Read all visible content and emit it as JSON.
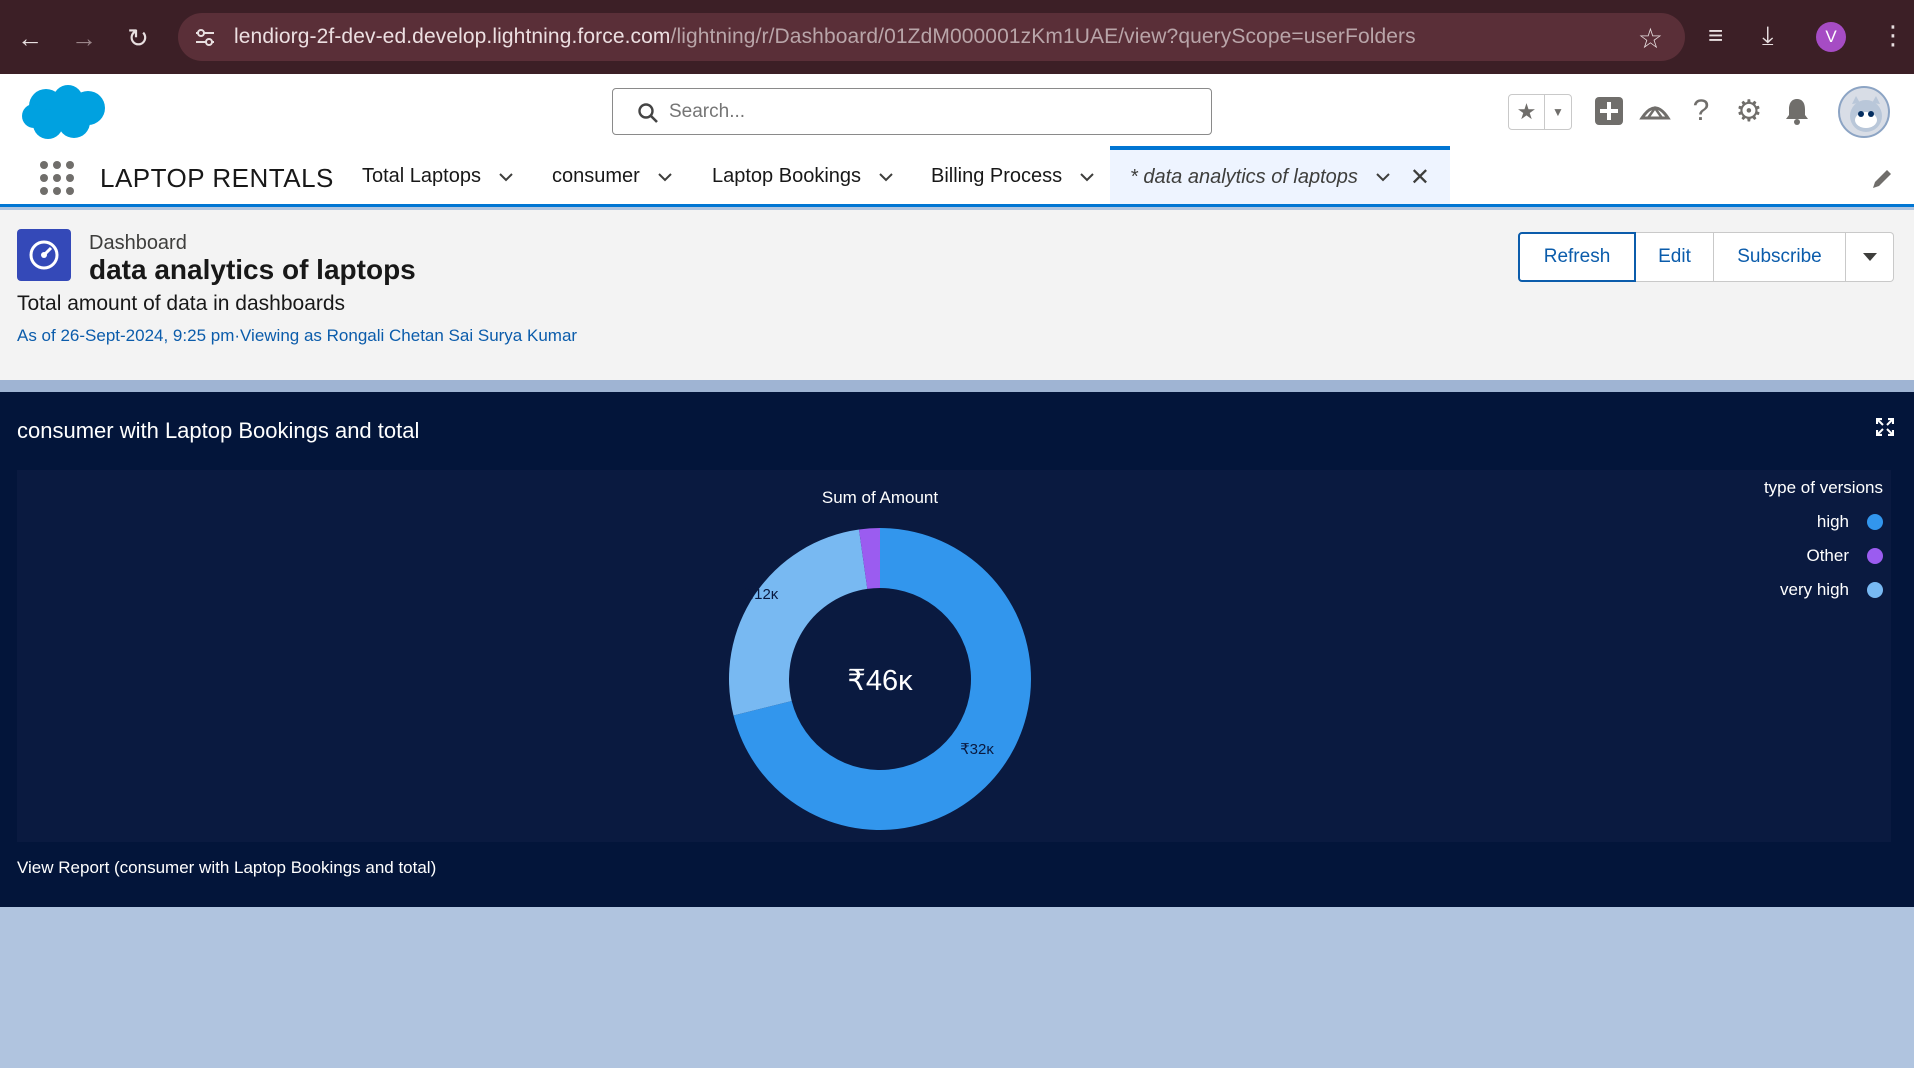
{
  "browser": {
    "url_main": "lendiorg-2f-dev-ed.develop.lightning.force.com",
    "url_rest": "/lightning/r/Dashboard/01ZdM000001zKm1UAE/view?queryScope=userFolders",
    "profile_initial": "V"
  },
  "header": {
    "search_placeholder": "Search..."
  },
  "nav": {
    "app_name": "LAPTOP RENTALS",
    "items": [
      {
        "label": "Total Laptops"
      },
      {
        "label": "consumer"
      },
      {
        "label": "Laptop Bookings"
      },
      {
        "label": "Billing Process"
      },
      {
        "label": "* data analytics of laptops"
      }
    ]
  },
  "dashboard": {
    "kicker": "Dashboard",
    "title": "data analytics of laptops",
    "description": "Total amount of data in dashboards",
    "as_of": "As of 26-Sept-2024, 9:25 pm·Viewing as Rongali Chetan Sai Surya Kumar",
    "buttons": {
      "refresh": "Refresh",
      "edit": "Edit",
      "subscribe": "Subscribe"
    }
  },
  "widget": {
    "title": "consumer with Laptop Bookings and total",
    "view_report": "View Report (consumer with Laptop Bookings and total)"
  },
  "chart_data": {
    "type": "donut",
    "title": "Sum of Amount",
    "center_label": "₹46ĸ",
    "legend_title": "type of versions",
    "legend_position": "top-right",
    "slices": [
      {
        "name": "high",
        "value": 32,
        "label": "₹32ĸ",
        "color": "#3296ed"
      },
      {
        "name": "very high",
        "value": 12,
        "label": "₹12ĸ",
        "color": "#78b9f2"
      },
      {
        "name": "Other",
        "value": 1,
        "label": "",
        "color": "#9b5cf0"
      }
    ],
    "legend": [
      {
        "name": "high",
        "color": "#3296ed"
      },
      {
        "name": "Other",
        "color": "#9b5cf0"
      },
      {
        "name": "very high",
        "color": "#78b9f2"
      }
    ]
  }
}
